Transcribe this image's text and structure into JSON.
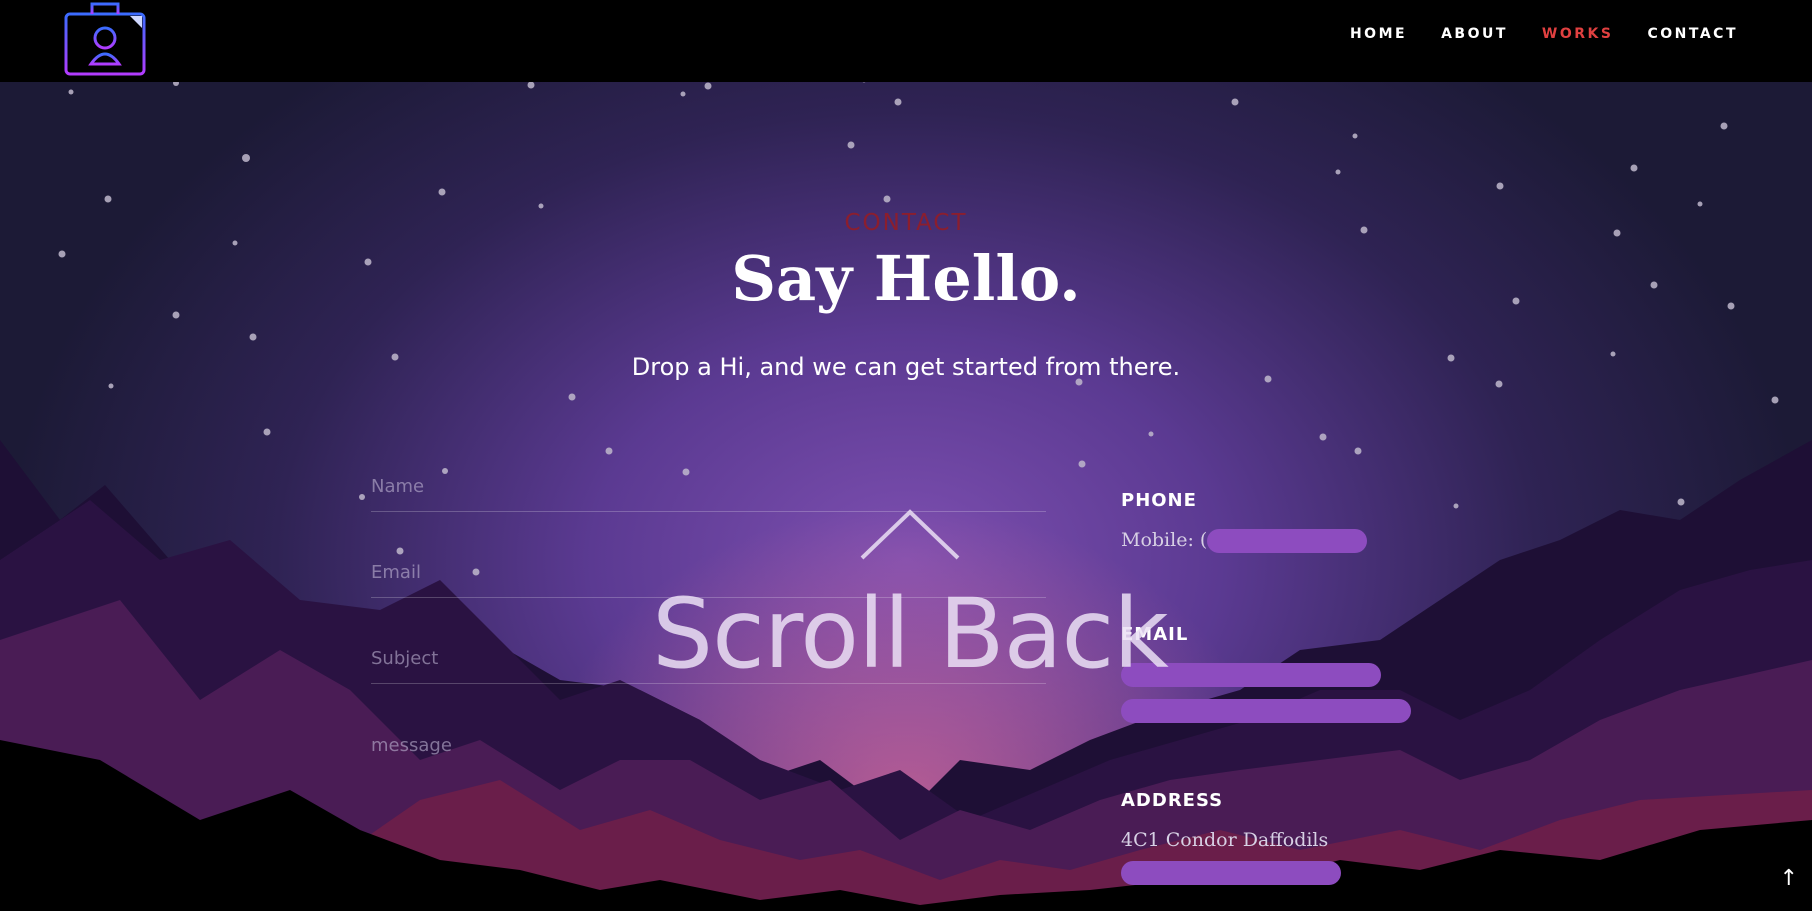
{
  "nav": {
    "items": [
      {
        "label": "HOME"
      },
      {
        "label": "ABOUT"
      },
      {
        "label": "WORKS"
      },
      {
        "label": "CONTACT"
      }
    ],
    "active": "WORKS"
  },
  "section": {
    "label": "CONTACT",
    "title": "Say Hello.",
    "subtitle": "Drop a Hi, and we can get started from there."
  },
  "form": {
    "name_placeholder": "Name",
    "email_placeholder": "Email",
    "subject_placeholder": "Subject",
    "message_placeholder": "message"
  },
  "scroll_back": {
    "label": "Scroll Back"
  },
  "contact_info": {
    "phone_heading": "PHONE",
    "phone_prefix": "Mobile: (",
    "email_heading": "EMAIL",
    "address_heading": "ADDRESS",
    "address_line1": "4C1 Condor Daffodils"
  },
  "to_top_icon": "arrow-up-icon",
  "colors": {
    "nav_active": "#e04040",
    "section_label": "#8b1e2e",
    "redaction": "#8d4cbf"
  }
}
